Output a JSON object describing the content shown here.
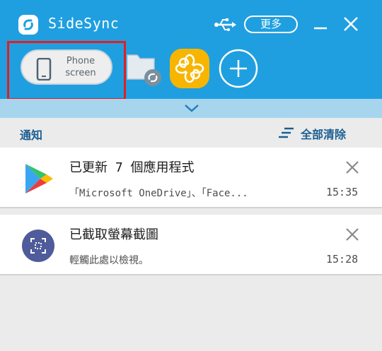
{
  "header": {
    "app_title": "SideSync",
    "more_label": "更多",
    "icons": [
      "sidesync-logo-icon",
      "usb-icon",
      "minimize-icon",
      "close-icon"
    ]
  },
  "toolbar": {
    "phone_screen_label_line1": "Phone",
    "phone_screen_label_line2": "screen",
    "shortcuts": [
      "folder-sync-icon",
      "app-shortcut-icon",
      "add-icon"
    ]
  },
  "notifications": {
    "title": "通知",
    "clear_all_label": "全部清除",
    "items": [
      {
        "icon": "play-store-icon",
        "title": "已更新 7 個應用程式",
        "text": "「Microsoft OneDrive」、「Face...",
        "time": "15:35"
      },
      {
        "icon": "screenshot-icon",
        "title": "已截取螢幕截圖",
        "text": "輕觸此處以檢視。",
        "time": "15:28"
      }
    ]
  },
  "colors": {
    "header_blue": "#1f9fe0",
    "strip_blue": "#a7d5ee",
    "accent_text": "#1a5e92",
    "highlight_red": "#e41e1e",
    "app_yellow": "#f7b500"
  }
}
